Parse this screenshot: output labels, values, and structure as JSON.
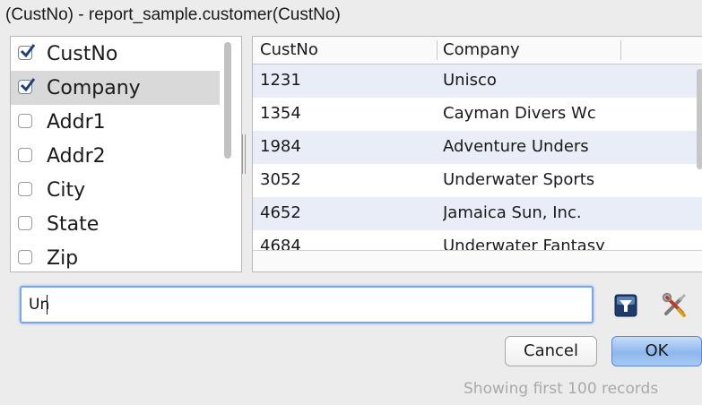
{
  "window": {
    "title": "(CustNo) - report_sample.customer(CustNo)"
  },
  "columns": [
    {
      "label": "CustNo",
      "checked": true
    },
    {
      "label": "Company",
      "checked": true
    },
    {
      "label": "Addr1",
      "checked": false
    },
    {
      "label": "Addr2",
      "checked": false
    },
    {
      "label": "City",
      "checked": false
    },
    {
      "label": "State",
      "checked": false
    },
    {
      "label": "Zip",
      "checked": false
    }
  ],
  "grid": {
    "headers": [
      "CustNo",
      "Company"
    ],
    "rows": [
      [
        "1231",
        "Unisco"
      ],
      [
        "1354",
        "Cayman Divers Wc"
      ],
      [
        "1984",
        "Adventure Unders"
      ],
      [
        "3052",
        "Underwater Sports"
      ],
      [
        "4652",
        "Jamaica Sun, Inc."
      ],
      [
        "4684",
        "Underwater Fantasy"
      ]
    ]
  },
  "search": {
    "value": "Un"
  },
  "icons": {
    "filter": "filter-icon",
    "tools": "tools-icon"
  },
  "buttons": {
    "cancel": "Cancel",
    "ok": "OK"
  },
  "status": "Showing first 100 records",
  "colors": {
    "accent": "#7aa6e8",
    "row_alt": "#e8edf7",
    "selection": "#d9d9d9"
  }
}
